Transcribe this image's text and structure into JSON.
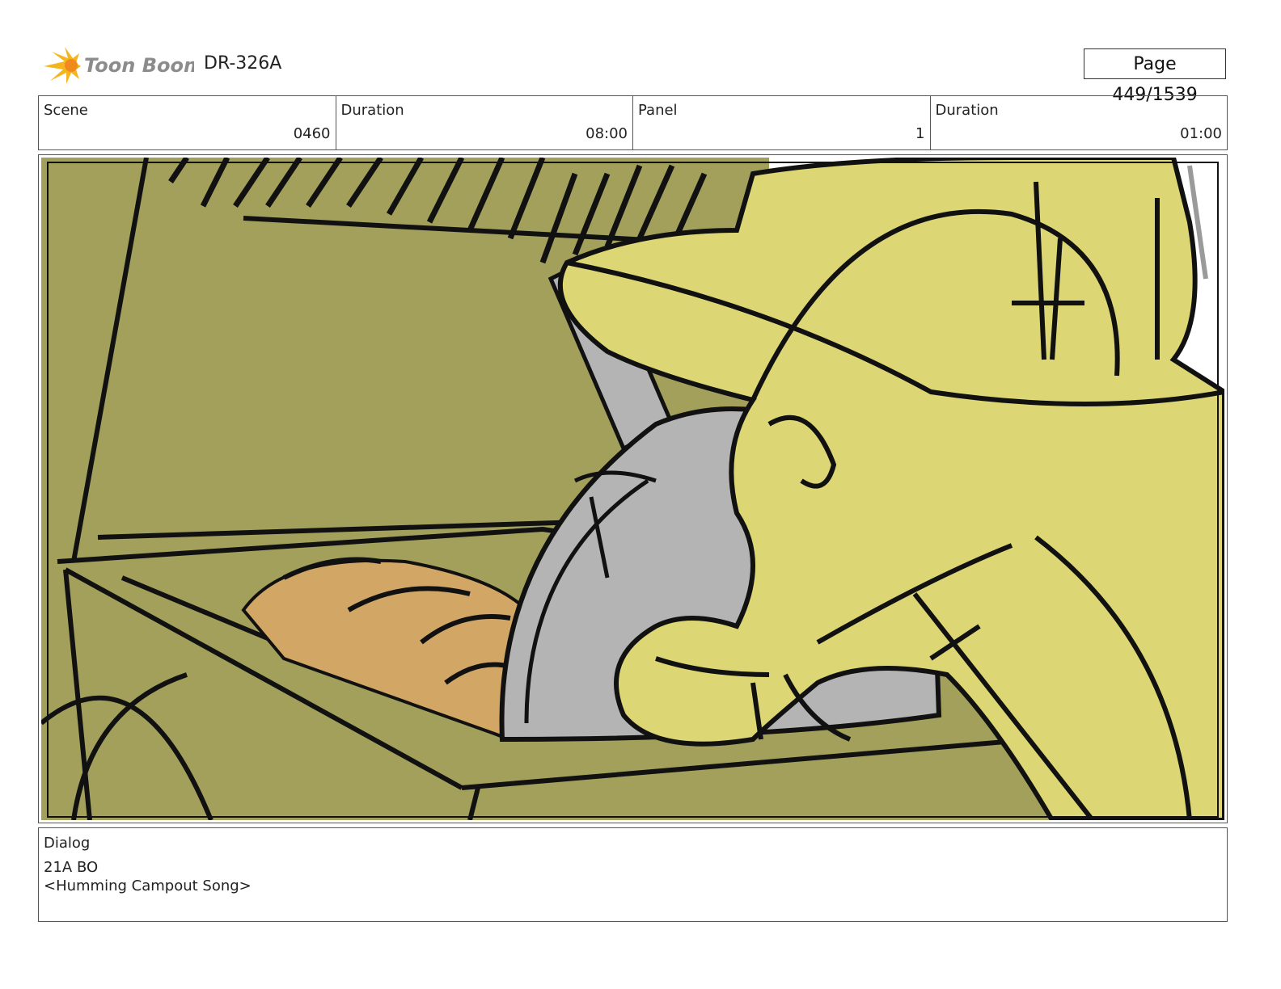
{
  "header": {
    "logo_text": "Toon Boom",
    "project_code": "DR-326A",
    "page_label": "Page",
    "page_value": "449/1539"
  },
  "info": {
    "scene_label": "Scene",
    "scene_value": "0460",
    "duration_label": "Duration",
    "duration_value": "08:00",
    "panel_label": "Panel",
    "panel_value": "1",
    "panel_duration_label": "Duration",
    "panel_duration_value": "01:00"
  },
  "dialog": {
    "label": "Dialog",
    "line1": "21A BO",
    "line2": "<Humming Campout Song>"
  },
  "colors": {
    "logo_orange": "#f5a623",
    "olive": "#a3a05c",
    "character_yellow": "#dcd674",
    "bread": "#d2a766",
    "pan_grey": "#b4b4b4"
  }
}
